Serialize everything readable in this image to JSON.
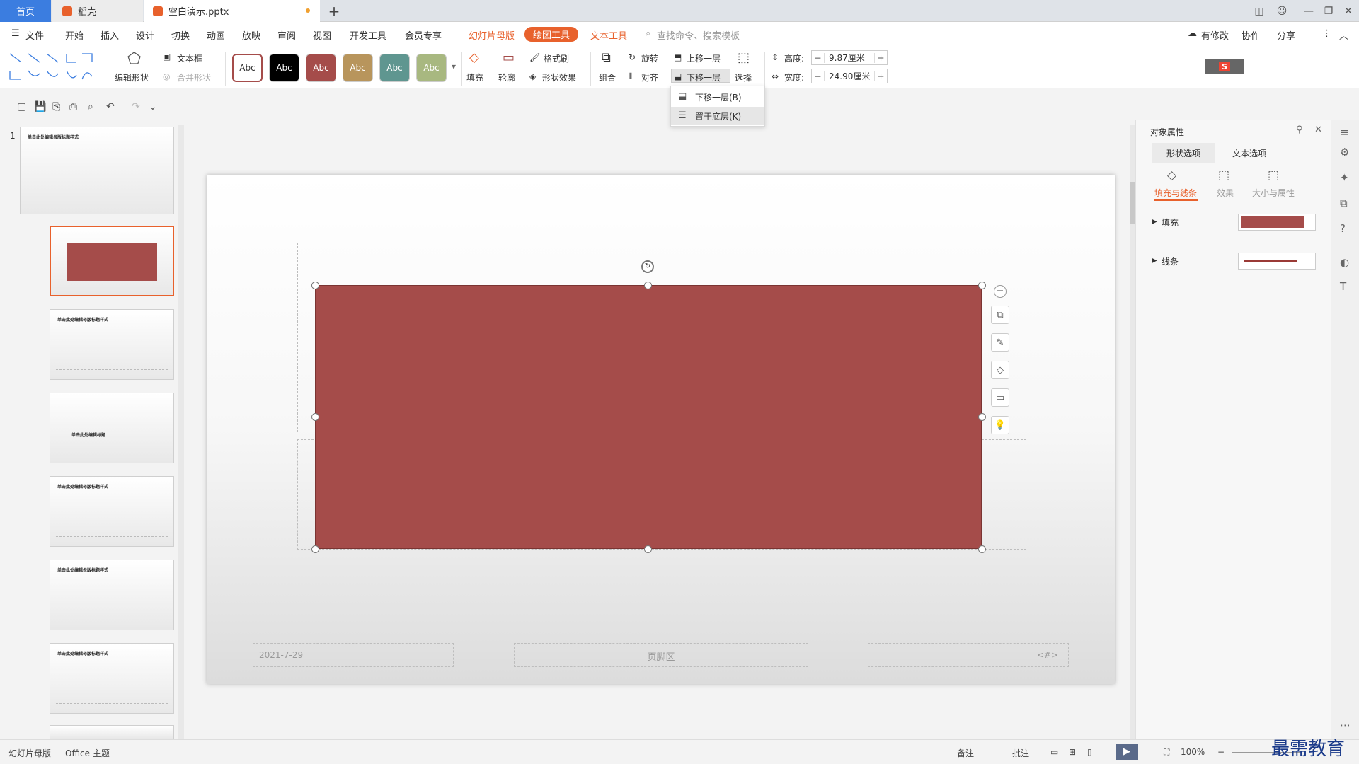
{
  "tabs": {
    "home": "首页",
    "daoke": "稻壳",
    "doc": "空白演示.pptx",
    "add": "+"
  },
  "window": {
    "min": "—",
    "restore": "❐",
    "close": "✕"
  },
  "menu": {
    "file": "文件",
    "items": [
      "开始",
      "插入",
      "设计",
      "切换",
      "动画",
      "放映",
      "审阅",
      "视图",
      "开发工具",
      "会员专享"
    ],
    "slide_master": "幻灯片母版",
    "draw_tools": "绘图工具",
    "text_tools": "文本工具",
    "search_placeholder": "查找命令、搜索模板",
    "has_changes": "有修改",
    "collab": "协作",
    "share": "分享"
  },
  "ribbon": {
    "textbox": "文本框",
    "edit_shape": "编辑形状",
    "merge_shape": "合并形状",
    "styles": [
      "Abc",
      "Abc",
      "Abc",
      "Abc",
      "Abc",
      "Abc"
    ],
    "style_colors": [
      "#ffffff",
      "#000000",
      "#a54c4a",
      "#b8955c",
      "#5f9690",
      "#a8b880"
    ],
    "fill": "填充",
    "outline": "轮廓",
    "format_painter": "格式刷",
    "shape_effect": "形状效果",
    "group": "组合",
    "rotate": "旋转",
    "align": "对齐",
    "bring_forward": "上移一层",
    "send_backward": "下移一层",
    "select": "选择",
    "height_label": "高度:",
    "height_value": "9.87厘米",
    "width_label": "宽度:",
    "width_value": "24.90厘米"
  },
  "dropdown": {
    "items": [
      "下移一层(B)",
      "置于底层(K)"
    ]
  },
  "thumbs": {
    "number": "1",
    "master_title": "单击此处编辑母版标题样式",
    "title_only": "单击此处编辑标题",
    "shape_color": "#a54c4a"
  },
  "slide": {
    "shape_color": "#a54c4a",
    "footer_date": "2021-7-29",
    "footer_center": "页脚区",
    "footer_num": "<#>"
  },
  "panel": {
    "title": "对象属性",
    "tab_shape": "形状选项",
    "tab_text": "文本选项",
    "sub_fill_line": "填充与线条",
    "sub_effect": "效果",
    "sub_size": "大小与属性",
    "fill_label": "填充",
    "line_label": "线条",
    "fill_color": "#a54c4a",
    "line_color": "#9a3a36"
  },
  "status": {
    "mode": "幻灯片母版",
    "theme": "Office 主题",
    "notes": "备注",
    "comment": "批注",
    "zoom": "100%",
    "watermark": "最需教育"
  }
}
